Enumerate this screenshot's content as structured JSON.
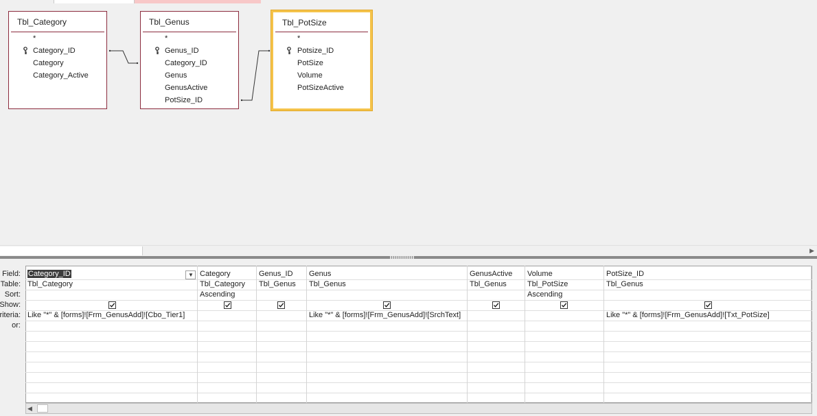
{
  "tables": [
    {
      "title": "Tbl_Category",
      "fields": [
        "*",
        "Category_ID",
        "Category",
        "Category_Active"
      ],
      "key_field": "Category_ID"
    },
    {
      "title": "Tbl_Genus",
      "fields": [
        "*",
        "Genus_ID",
        "Category_ID",
        "Genus",
        "GenusActive",
        "PotSize_ID"
      ],
      "key_field": "Genus_ID"
    },
    {
      "title": "Tbl_PotSize",
      "fields": [
        "*",
        "Potsize_ID",
        "PotSize",
        "Volume",
        "PotSizeActive"
      ],
      "key_field": "Potsize_ID"
    }
  ],
  "row_labels": [
    "Field:",
    "Table:",
    "Sort:",
    "Show:",
    "riteria:",
    "or:"
  ],
  "columns": [
    {
      "field": "Category_ID",
      "table": "Tbl_Category",
      "sort": "",
      "show": true,
      "criteria": "Like \"*\" & [forms]![Frm_GenusAdd]![Cbo_Tier1]"
    },
    {
      "field": "Category",
      "table": "Tbl_Category",
      "sort": "Ascending",
      "show": true,
      "criteria": ""
    },
    {
      "field": "Genus_ID",
      "table": "Tbl_Genus",
      "sort": "",
      "show": true,
      "criteria": ""
    },
    {
      "field": "Genus",
      "table": "Tbl_Genus",
      "sort": "",
      "show": true,
      "criteria": "Like \"*\" & [forms]![Frm_GenusAdd]![SrchText]"
    },
    {
      "field": "GenusActive",
      "table": "Tbl_Genus",
      "sort": "",
      "show": true,
      "criteria": ""
    },
    {
      "field": "Volume",
      "table": "Tbl_PotSize",
      "sort": "Ascending",
      "show": true,
      "criteria": ""
    },
    {
      "field": "PotSize_ID",
      "table": "Tbl_Genus",
      "sort": "",
      "show": true,
      "criteria": "Like \"*\" & [forms]![Frm_GenusAdd]![Txt_PotSize]"
    }
  ],
  "colors": {
    "table_border": "#8b2a3c",
    "selected_table_border": "#f5c34a",
    "pane_background": "#f0f0f0",
    "tab_highlight": "#f8c8c8"
  },
  "icons": {
    "primary_key": "key-icon",
    "combo": "chevron-down-icon",
    "show": "checkbox-checked-icon"
  }
}
